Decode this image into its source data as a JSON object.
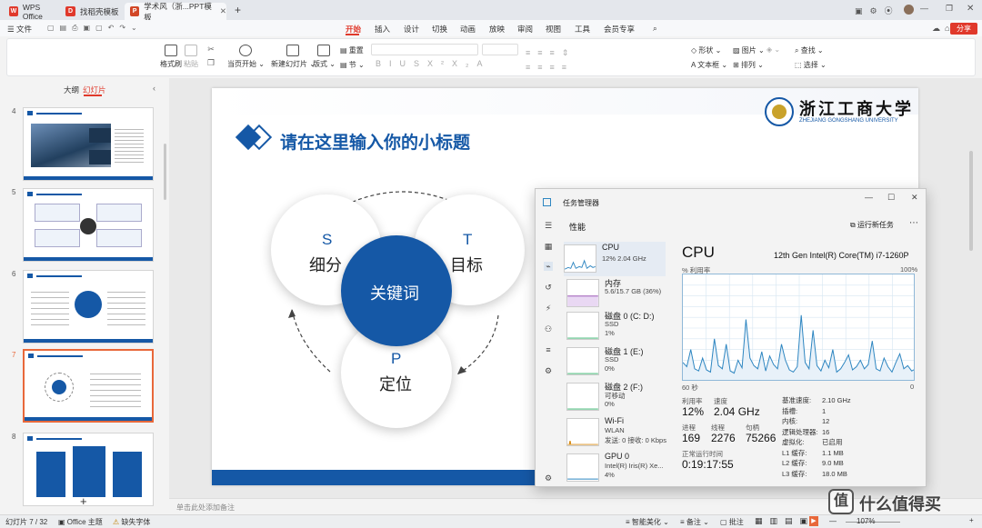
{
  "titlebar": {
    "tabs": [
      {
        "label": "WPS Office",
        "icon": "wps-logo-icon",
        "color": "#e0392b"
      },
      {
        "label": "找稻壳模板",
        "icon": "docer-icon",
        "color": "#e0392b"
      },
      {
        "label": "学术风（浙...PPT模板",
        "icon": "ppt-icon",
        "color": "#d24726"
      }
    ],
    "new_tab": "+"
  },
  "menubar": {
    "file": "文件",
    "items": [
      "开始",
      "插入",
      "设计",
      "切换",
      "动画",
      "放映",
      "审阅",
      "视图",
      "工具",
      "会员专享"
    ],
    "active": "开始",
    "share": "分享"
  },
  "ribbon": {
    "format_painter": "格式刷",
    "paste": "粘贴",
    "play_current": "当页开始",
    "new_slide": "新建幻灯片",
    "layout": "版式",
    "reset": "重置",
    "section": "节",
    "shape": "形状",
    "picture": "图片",
    "textbox": "文本框",
    "arrange": "排列",
    "find": "查找",
    "select": "选择"
  },
  "leftpanel": {
    "tab_outline": "大纲",
    "tab_slides": "幻灯片",
    "slide_numbers": [
      "4",
      "5",
      "6",
      "7",
      "8"
    ],
    "selected": "7",
    "add": "+"
  },
  "slide": {
    "subtitle": "请在这里输入你的小标题",
    "university_cn": "浙江工商大学",
    "university_en": "ZHEJIANG GONGSHANG UNIVERSITY",
    "center": "关键词",
    "s_letter": "S",
    "s_label": "细分",
    "t_letter": "T",
    "t_label": "目标",
    "p_letter": "P",
    "p_label": "定位"
  },
  "notes_placeholder": "单击此处添加备注",
  "statusbar": {
    "slide_pos": "幻灯片 7 / 32",
    "theme": "Office 主题",
    "missing_font": "缺失字体",
    "smart": "智能美化",
    "notes": "备注",
    "comment": "批注",
    "zoom": "107%"
  },
  "taskmgr": {
    "title": "任务管理器",
    "section": "性能",
    "run_new": "运行新任务",
    "items": [
      {
        "name": "CPU",
        "line1": "12% 2.04 GHz",
        "line2": ""
      },
      {
        "name": "内存",
        "line1": "5.6/15.7 GB (36%)",
        "line2": ""
      },
      {
        "name": "磁盘 0 (C: D:)",
        "line1": "SSD",
        "line2": "1%"
      },
      {
        "name": "磁盘 1 (E:)",
        "line1": "SSD",
        "line2": "0%"
      },
      {
        "name": "磁盘 2 (F:)",
        "line1": "可移动",
        "line2": "0%"
      },
      {
        "name": "Wi-Fi",
        "line1": "WLAN",
        "line2": "发送: 0 接收: 0 Kbps"
      },
      {
        "name": "GPU 0",
        "line1": "Intel(R) Iris(R) Xe...",
        "line2": "4%"
      }
    ],
    "cpu_title": "CPU",
    "cpu_model": "12th Gen Intel(R) Core(TM) i7-1260P",
    "util_label": "% 利用率",
    "util_max": "100%",
    "axis_left": "60 秒",
    "axis_right": "0",
    "stats": {
      "util_label": "利用率",
      "util_val": "12%",
      "speed_label": "速度",
      "speed_val": "2.04 GHz",
      "proc_label": "进程",
      "proc_val": "169",
      "thread_label": "线程",
      "thread_val": "2276",
      "handle_label": "句柄",
      "handle_val": "75266",
      "uptime_label": "正常运行时间",
      "uptime_val": "0:19:17:55"
    },
    "specs": [
      [
        "基准速度:",
        "2.10 GHz"
      ],
      [
        "插槽:",
        "1"
      ],
      [
        "内核:",
        "12"
      ],
      [
        "逻辑处理器:",
        "16"
      ],
      [
        "虚拟化:",
        "已启用"
      ],
      [
        "L1 缓存:",
        "1.1 MB"
      ],
      [
        "L2 缓存:",
        "9.0 MB"
      ],
      [
        "L3 缓存:",
        "18.0 MB"
      ]
    ],
    "cpu_history_pct": [
      18,
      14,
      30,
      12,
      10,
      22,
      11,
      9,
      40,
      15,
      12,
      35,
      10,
      8,
      20,
      13,
      58,
      22,
      15,
      12,
      28,
      10,
      24,
      16,
      12,
      35,
      20,
      11,
      9,
      14,
      62,
      18,
      12,
      48,
      15,
      10,
      20,
      13,
      30,
      9,
      12,
      18,
      25,
      11,
      14,
      20,
      12,
      16,
      38,
      12,
      10,
      22,
      14,
      9,
      18,
      26,
      12,
      15,
      10,
      12
    ]
  },
  "watermark": "什么值得买",
  "colors": {
    "accent": "#e0392b",
    "slide_blue": "#1558a6",
    "cpu_line": "#2e86c1"
  }
}
